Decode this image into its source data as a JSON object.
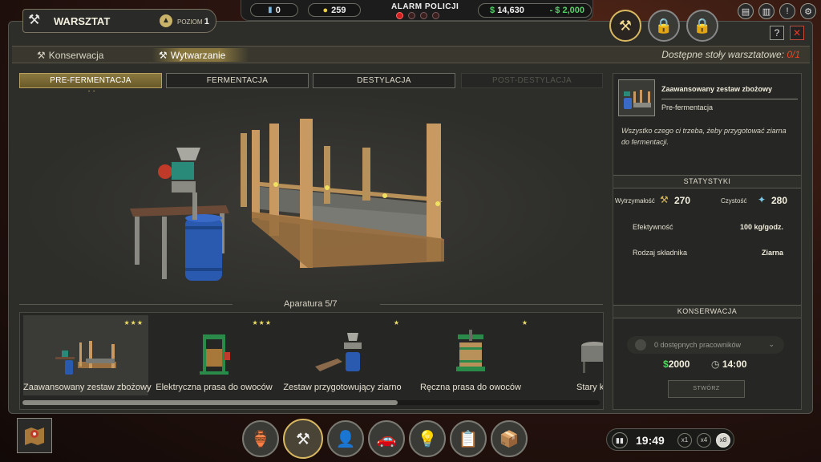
{
  "topbar": {
    "counter_value": "0",
    "bulbs_value": "259",
    "alarm_label": "ALARM POLICJI",
    "alarm_levels": [
      true,
      false,
      false,
      false
    ],
    "cash": "14,630",
    "debt": "- $ 2,000",
    "currency_symbol": "$",
    "icons": [
      "book-icon",
      "stats-icon",
      "info-icon",
      "settings-icon"
    ]
  },
  "window": {
    "title": "WARSZTAT",
    "level_label": "POZIOM",
    "level_value": "1",
    "help_label": "?",
    "close_label": "✕"
  },
  "main_tabs": [
    {
      "label": "Konserwacja",
      "active": false
    },
    {
      "label": "Wytwarzanie",
      "active": true
    }
  ],
  "tables_info": {
    "label": "Dostępne stoły warsztatowe:",
    "value": "0/1"
  },
  "sub_tabs": [
    {
      "label": "PRE-FERMENTACJA",
      "state": "active"
    },
    {
      "label": "FERMENTACJA",
      "state": "normal"
    },
    {
      "label": "DESTYLACJA",
      "state": "normal"
    },
    {
      "label": "POST-DESTYLACJA",
      "state": "disabled"
    }
  ],
  "apparatus": {
    "label": "Aparatura 5/7",
    "items": [
      {
        "label": "Zaawansowany zestaw zbożowy",
        "stars": "★★★",
        "selected": true
      },
      {
        "label": "Elektryczna prasa do owoców",
        "stars": "★★★",
        "selected": false
      },
      {
        "label": "Zestaw przygotowujący ziarno",
        "stars": "★",
        "selected": false
      },
      {
        "label": "Ręczna prasa do owoców",
        "stars": "★",
        "selected": false
      },
      {
        "label": "Stary kocioł",
        "stars": "",
        "selected": false
      }
    ],
    "scroll_fraction": 0.65
  },
  "info": {
    "name": "Zaawansowany zestaw zbożowy",
    "stage": "Pre-fermentacja",
    "description": "Wszystko czego ci trzeba, żeby przygotować ziarna do fermentacji.",
    "stats_header": "STATYSTYKI",
    "durability_label": "Wytrzymałość",
    "durability_value": "270",
    "cleanliness_label": "Czystość",
    "cleanliness_value": "280",
    "efficiency_label": "Efektywność",
    "efficiency_value": "100 kg/godz.",
    "ingredient_label": "Rodzaj składnika",
    "ingredient_value": "Ziarna",
    "maintenance_header": "KONSERWACJA",
    "workers_placeholder": "0 dostępnych pracowników",
    "cost": "2000",
    "cost_symbol": "$",
    "duration": "14:00",
    "create_label": "STWÓRZ"
  },
  "bottom": {
    "time": "19:49",
    "speeds": [
      "x1",
      "x4",
      "x8"
    ],
    "active_speed": "x8",
    "dock": [
      {
        "name": "moonshine-jug-icon",
        "glyph": "🏺",
        "active": false
      },
      {
        "name": "tools-icon",
        "glyph": "⚒",
        "active": true
      },
      {
        "name": "worker-icon",
        "glyph": "👤",
        "active": false
      },
      {
        "name": "car-icon",
        "glyph": "🚗",
        "active": false
      },
      {
        "name": "lightbulb-icon",
        "glyph": "💡",
        "active": false
      },
      {
        "name": "notebook-icon",
        "glyph": "📋",
        "active": false
      },
      {
        "name": "boxes-icon",
        "glyph": "📦",
        "active": false
      }
    ]
  }
}
